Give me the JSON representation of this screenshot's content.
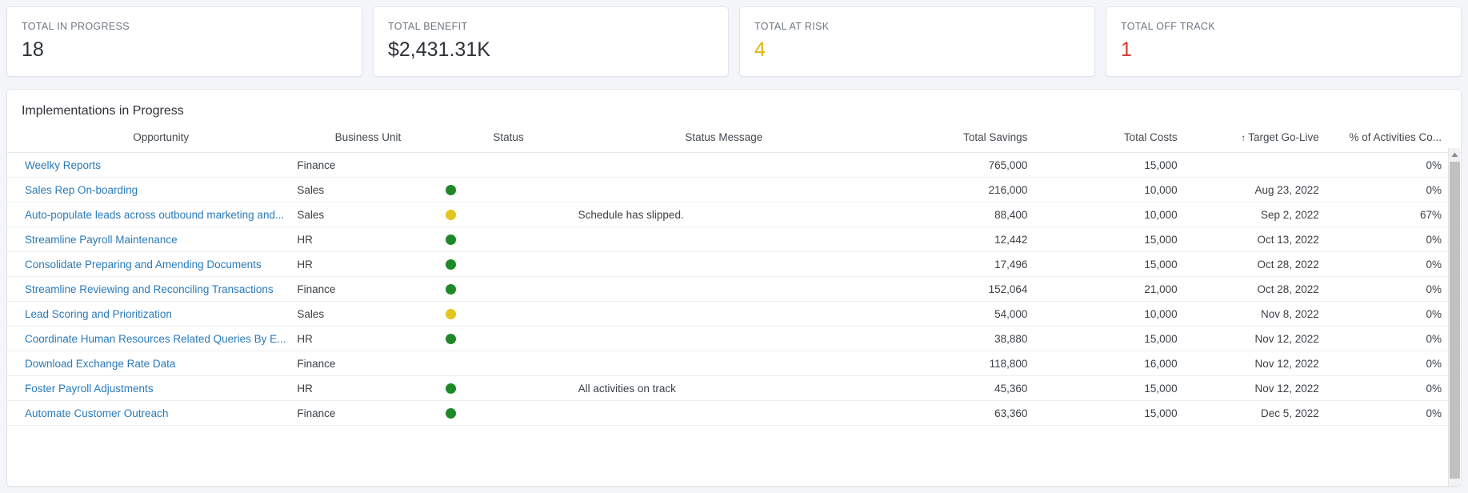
{
  "colors": {
    "page_bg": "#f3f5f8",
    "card_bg": "#ffffff",
    "border": "#e2e6eb",
    "link": "#2a7ab9",
    "status_green": "#1d8a27",
    "status_yellow": "#e4c41f",
    "status_red": "#c8372a",
    "kpi_warn": "#e0b50d",
    "kpi_danger": "#d13b2e"
  },
  "kpis": [
    {
      "label": "TOTAL IN PROGRESS",
      "value": "18",
      "accent": ""
    },
    {
      "label": "TOTAL BENEFIT",
      "value": "$2,431.31K",
      "accent": ""
    },
    {
      "label": "TOTAL AT RISK",
      "value": "4",
      "accent": "accent-warn"
    },
    {
      "label": "TOTAL OFF TRACK",
      "value": "1",
      "accent": "accent-danger"
    }
  ],
  "panel": {
    "title": "Implementations in Progress",
    "sort_icon": "↑",
    "sorted_column": "Target Go-Live",
    "scroll_up_icon": "scroll-up-arrow-icon",
    "columns": [
      {
        "key": "opportunity",
        "label": "Opportunity"
      },
      {
        "key": "business_unit",
        "label": "Business Unit"
      },
      {
        "key": "status",
        "label": "Status"
      },
      {
        "key": "status_message",
        "label": "Status Message"
      },
      {
        "key": "total_savings",
        "label": "Total Savings"
      },
      {
        "key": "total_costs",
        "label": "Total Costs"
      },
      {
        "key": "target_go_live",
        "label": "Target Go-Live"
      },
      {
        "key": "pct_activities",
        "label": "% of Activities Co..."
      }
    ],
    "rows": [
      {
        "opportunity": "Weelky Reports",
        "business_unit": "Finance",
        "status": "none",
        "status_message": "",
        "total_savings": "765,000",
        "total_costs": "15,000",
        "target_go_live": "",
        "pct_activities": "0%"
      },
      {
        "opportunity": "Sales Rep On-boarding",
        "business_unit": "Sales",
        "status": "green",
        "status_message": "",
        "total_savings": "216,000",
        "total_costs": "10,000",
        "target_go_live": "Aug 23, 2022",
        "pct_activities": "0%"
      },
      {
        "opportunity": "Auto-populate leads across outbound marketing and...",
        "business_unit": "Sales",
        "status": "yellow",
        "status_message": "Schedule has slipped.",
        "total_savings": "88,400",
        "total_costs": "10,000",
        "target_go_live": "Sep 2, 2022",
        "pct_activities": "67%"
      },
      {
        "opportunity": "Streamline Payroll Maintenance",
        "business_unit": "HR",
        "status": "green",
        "status_message": "",
        "total_savings": "12,442",
        "total_costs": "15,000",
        "target_go_live": "Oct 13, 2022",
        "pct_activities": "0%"
      },
      {
        "opportunity": "Consolidate Preparing and Amending Documents",
        "business_unit": "HR",
        "status": "green",
        "status_message": "",
        "total_savings": "17,496",
        "total_costs": "15,000",
        "target_go_live": "Oct 28, 2022",
        "pct_activities": "0%"
      },
      {
        "opportunity": "Streamline Reviewing and Reconciling Transactions",
        "business_unit": "Finance",
        "status": "green",
        "status_message": "",
        "total_savings": "152,064",
        "total_costs": "21,000",
        "target_go_live": "Oct 28, 2022",
        "pct_activities": "0%"
      },
      {
        "opportunity": "Lead Scoring and Prioritization",
        "business_unit": "Sales",
        "status": "yellow",
        "status_message": "",
        "total_savings": "54,000",
        "total_costs": "10,000",
        "target_go_live": "Nov 8, 2022",
        "pct_activities": "0%"
      },
      {
        "opportunity": "Coordinate Human Resources Related Queries By E...",
        "business_unit": "HR",
        "status": "green",
        "status_message": "",
        "total_savings": "38,880",
        "total_costs": "15,000",
        "target_go_live": "Nov 12, 2022",
        "pct_activities": "0%"
      },
      {
        "opportunity": "Download Exchange Rate Data",
        "business_unit": "Finance",
        "status": "none",
        "status_message": "",
        "total_savings": "118,800",
        "total_costs": "16,000",
        "target_go_live": "Nov 12, 2022",
        "pct_activities": "0%"
      },
      {
        "opportunity": "Foster Payroll Adjustments",
        "business_unit": "HR",
        "status": "green",
        "status_message": "All activities on track",
        "total_savings": "45,360",
        "total_costs": "15,000",
        "target_go_live": "Nov 12, 2022",
        "pct_activities": "0%"
      },
      {
        "opportunity": "Automate Customer Outreach",
        "business_unit": "Finance",
        "status": "green",
        "status_message": "",
        "total_savings": "63,360",
        "total_costs": "15,000",
        "target_go_live": "Dec 5, 2022",
        "pct_activities": "0%"
      }
    ]
  }
}
